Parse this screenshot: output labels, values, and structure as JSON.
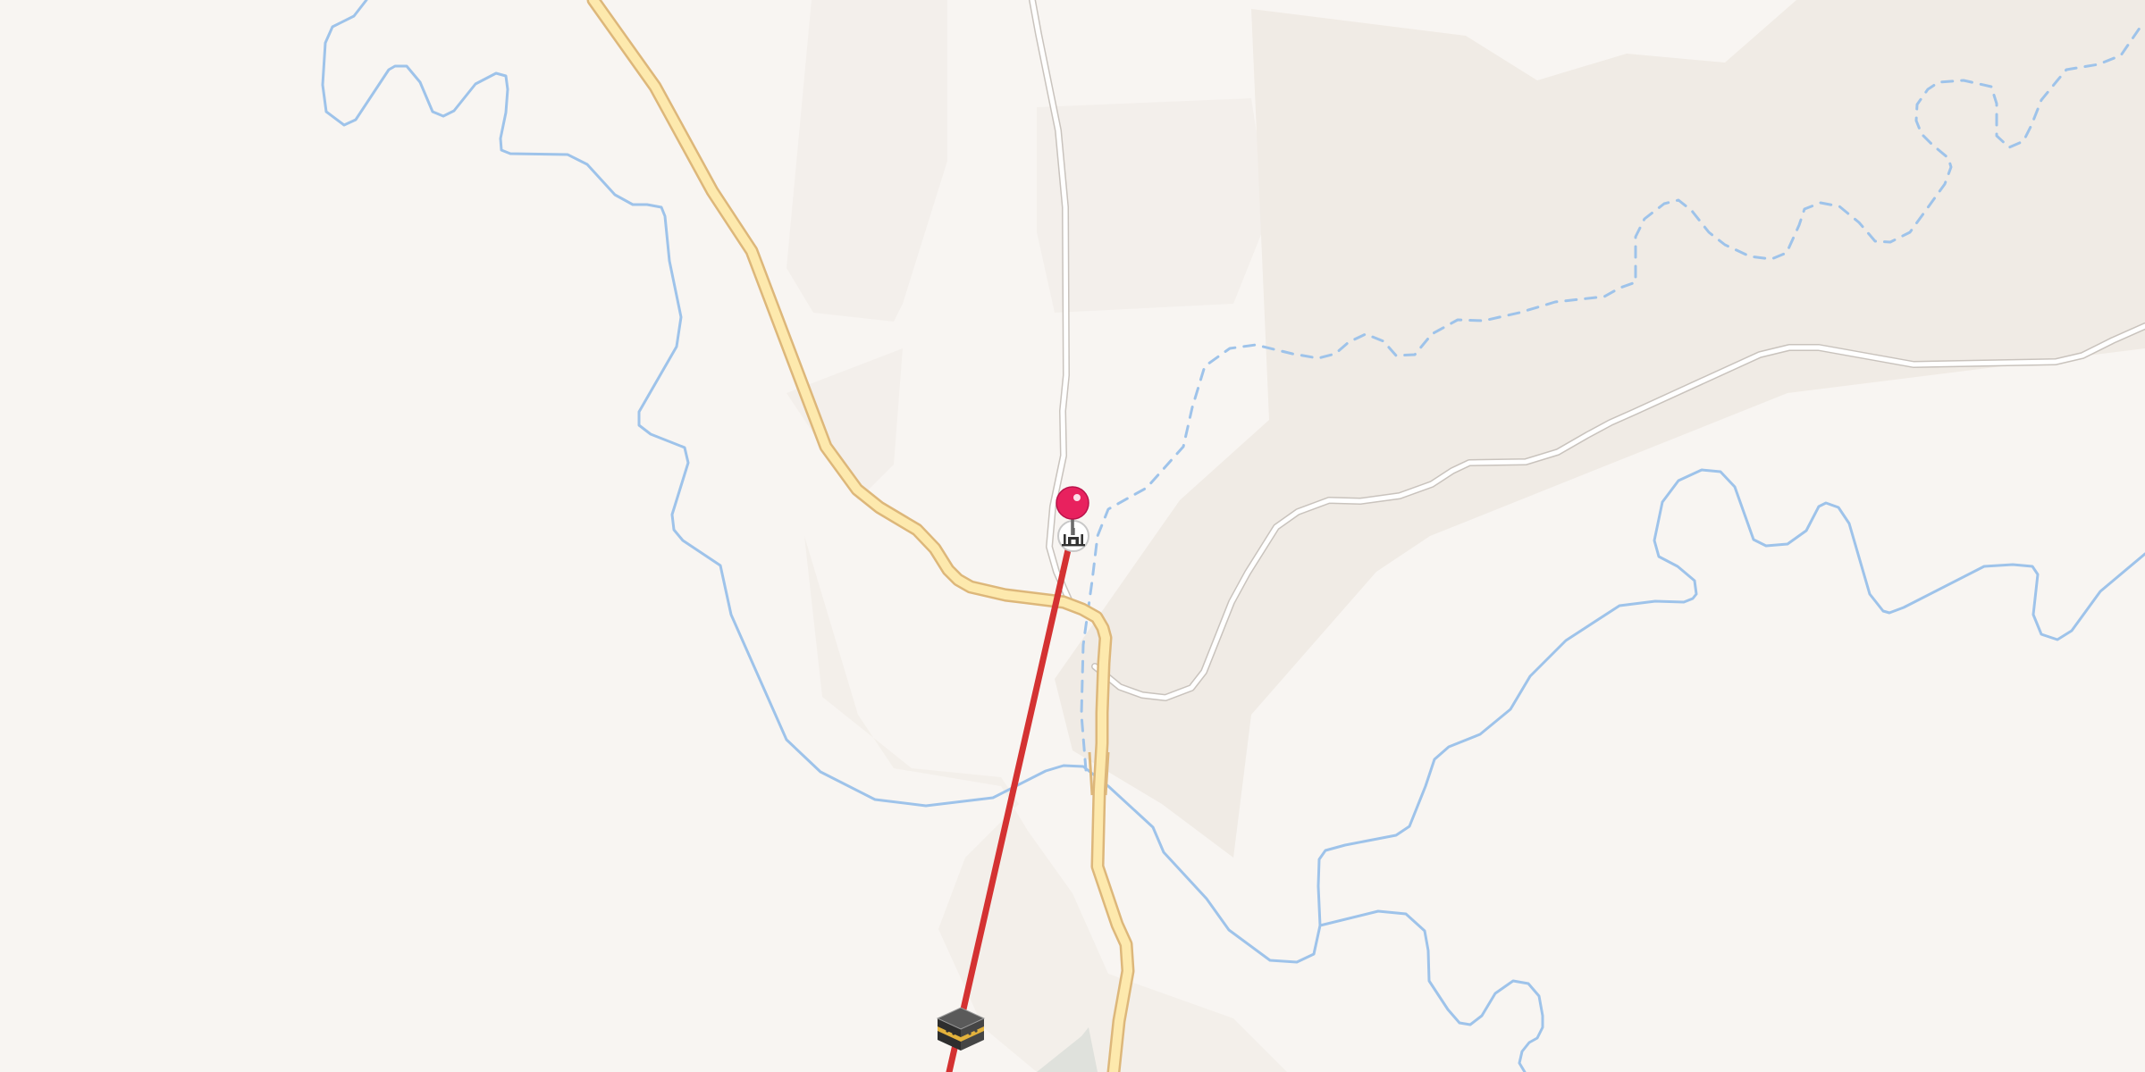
{
  "map": {
    "style": "light street map",
    "colors": {
      "background": "#f8f5f2",
      "major_road": "#fde9ad",
      "major_road_casing": "#ddb77a",
      "minor_road": "#ffffff",
      "waterway": "#9ec3ea",
      "direction_line": "#d43232",
      "pin": "#e8215e"
    },
    "markers": {
      "location_pin": {
        "icon": "location-pin-icon",
        "color": "#e8215e"
      },
      "mosque": {
        "icon": "mosque-icon"
      },
      "kaaba": {
        "icon": "kaaba-icon"
      }
    },
    "direction_line": {
      "from": "mosque",
      "to": "kaaba",
      "color": "#d43232"
    }
  }
}
